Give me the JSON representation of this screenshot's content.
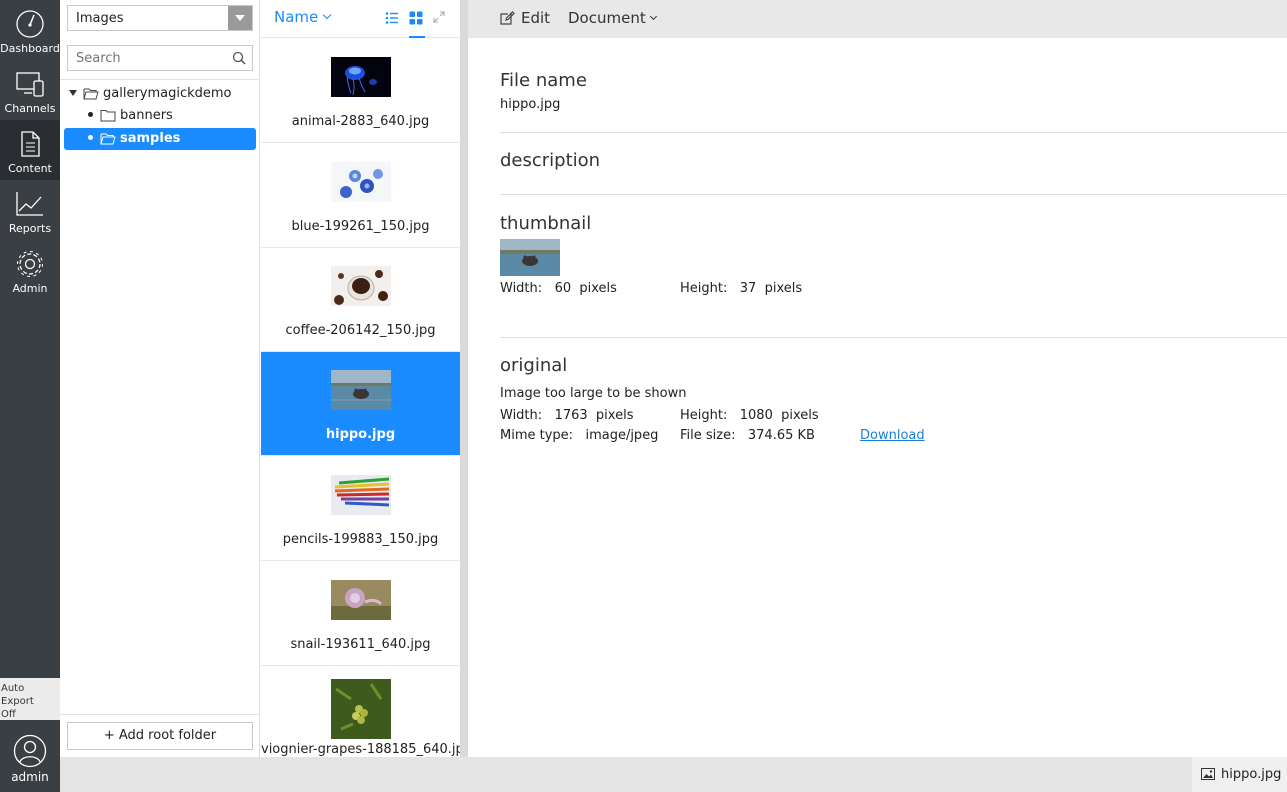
{
  "nav": {
    "items": [
      {
        "label": "Dashboard",
        "icon": "gauge-icon"
      },
      {
        "label": "Channels",
        "icon": "devices-icon"
      },
      {
        "label": "Content",
        "icon": "document-icon"
      },
      {
        "label": "Reports",
        "icon": "chart-icon"
      },
      {
        "label": "Admin",
        "icon": "gear-icon"
      }
    ],
    "active": "Content",
    "auto_export": [
      "Auto",
      "Export",
      "Off"
    ],
    "user": "admin"
  },
  "folders": {
    "type_select": "Images",
    "search_placeholder": "Search",
    "tree": [
      {
        "label": "gallerymagickdemo",
        "expanded": true
      },
      {
        "label": "banners"
      },
      {
        "label": "samples",
        "selected": true
      }
    ],
    "add_root_label": "+ Add root folder"
  },
  "list": {
    "sort_label": "Name",
    "items": [
      {
        "name": "animal-2883_640.jpg"
      },
      {
        "name": "blue-199261_150.jpg"
      },
      {
        "name": "coffee-206142_150.jpg"
      },
      {
        "name": "hippo.jpg",
        "selected": true
      },
      {
        "name": "pencils-199883_150.jpg"
      },
      {
        "name": "snail-193611_640.jpg"
      },
      {
        "name": "viognier-grapes-188185_640.jpg"
      }
    ]
  },
  "toolbar": {
    "edit_label": "Edit",
    "document_label": "Document"
  },
  "detail": {
    "file_name_title": "File name",
    "file_name_value": "hippo.jpg",
    "description_title": "description",
    "thumbnail": {
      "title": "thumbnail",
      "width_label": "Width:",
      "width_value": "60",
      "width_unit": "pixels",
      "height_label": "Height:",
      "height_value": "37",
      "height_unit": "pixels"
    },
    "original": {
      "title": "original",
      "note": "Image too large to be shown",
      "width_label": "Width:",
      "width_value": "1763",
      "width_unit": "pixels",
      "height_label": "Height:",
      "height_value": "1080",
      "height_unit": "pixels",
      "mime_label": "Mime type:",
      "mime_value": "image/jpeg",
      "size_label": "File size:",
      "size_value": "374.65 KB",
      "download_label": "Download"
    }
  },
  "status": {
    "tab_label": "hippo.jpg"
  },
  "colors": {
    "accent": "#1a8cff",
    "nav_bg": "#3a3f44"
  }
}
